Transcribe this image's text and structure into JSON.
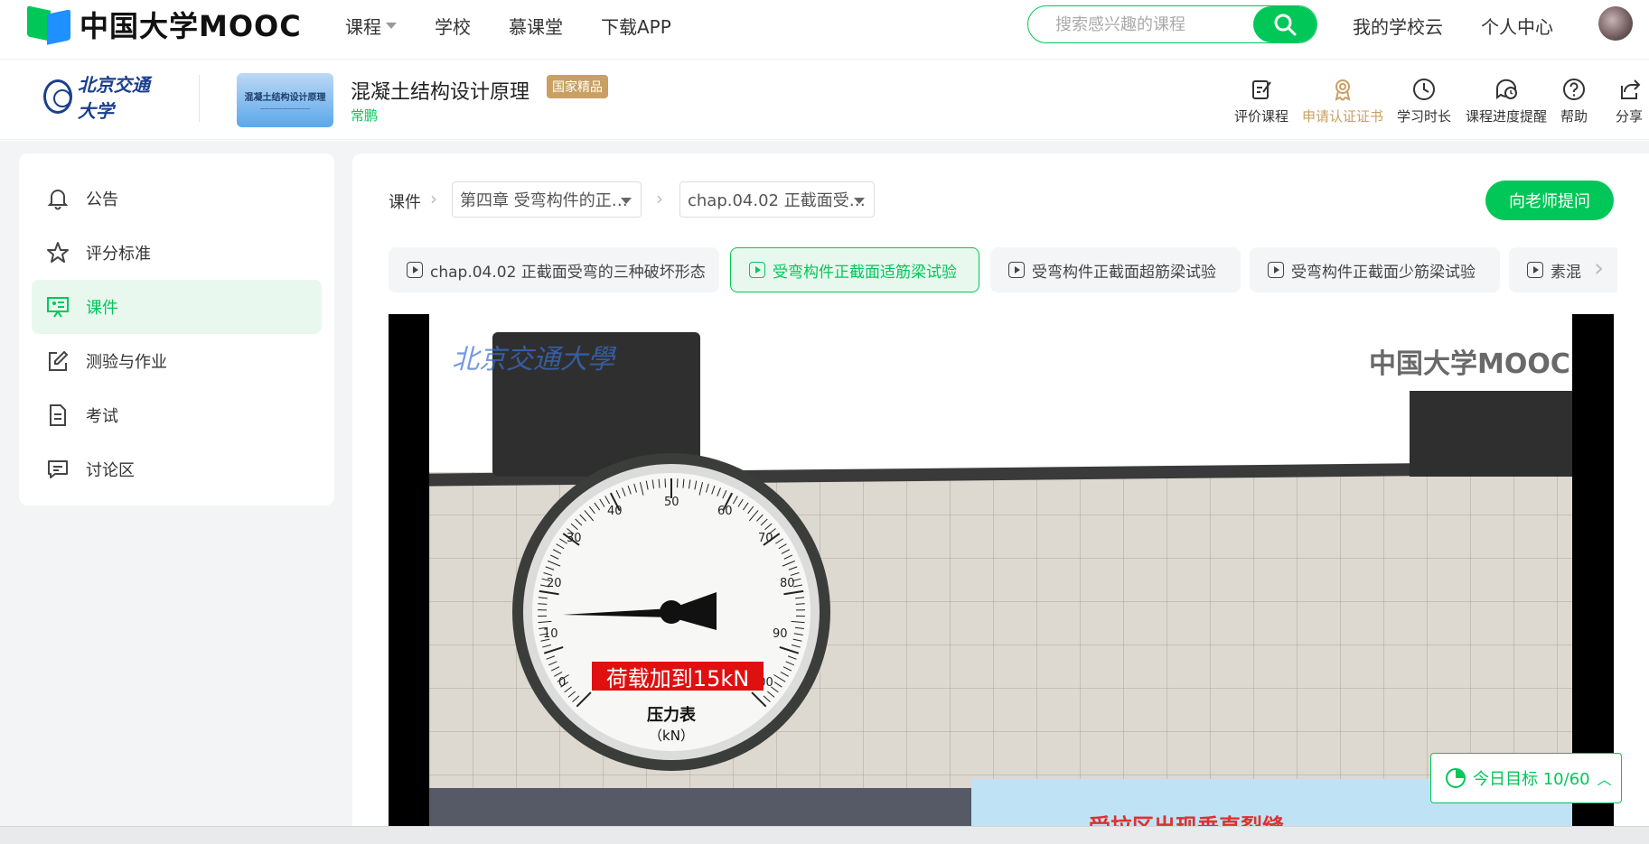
{
  "topbar": {
    "logo_text": "中国大学MOOC",
    "nav": [
      "课程",
      "学校",
      "慕课堂",
      "下载APP"
    ],
    "search_placeholder": "搜索感兴趣的课程",
    "links": [
      "我的学校云",
      "个人中心"
    ]
  },
  "course": {
    "school_name": "北京交通大学",
    "thumb_title": "混凝土结构设计原理",
    "title": "混凝土结构设计原理",
    "badge": "国家精品",
    "teacher": "常鹏",
    "tools": [
      "评价课程",
      "申请认证证书",
      "学习时长",
      "课程进度提醒",
      "帮助",
      "分享"
    ]
  },
  "sidebar": {
    "items": [
      "公告",
      "评分标准",
      "课件",
      "测验与作业",
      "考试",
      "讨论区"
    ],
    "active_index": 2
  },
  "breadcrumb": {
    "label": "课件",
    "chapter": "第四章 受弯构件的正…",
    "section": "chap.04.02 正截面受…"
  },
  "ask_button": "向老师提问",
  "tabs": [
    "chap.04.02 正截面受弯的三种破坏形态",
    "受弯构件正截面适筋梁试验",
    "受弯构件正截面超筋梁试验",
    "受弯构件正截面少筋梁试验",
    "素混"
  ],
  "video": {
    "watermark": "中国大学MOOC",
    "uni_mark": "北京交通大學",
    "gauge_ticks": [
      "0",
      "10",
      "20",
      "30",
      "40",
      "50",
      "60",
      "70",
      "80",
      "90",
      "100"
    ],
    "gauge_label": "压力表",
    "gauge_unit": "（kN）",
    "caption": "荷载加到15kN",
    "crack_text": "受拉区出现垂直裂缝"
  },
  "goal": {
    "label": "今日目标 10/60"
  },
  "colors": {
    "brand_green": "#00c758",
    "badge_gold": "#c9a063",
    "caption_red": "#e01010"
  }
}
